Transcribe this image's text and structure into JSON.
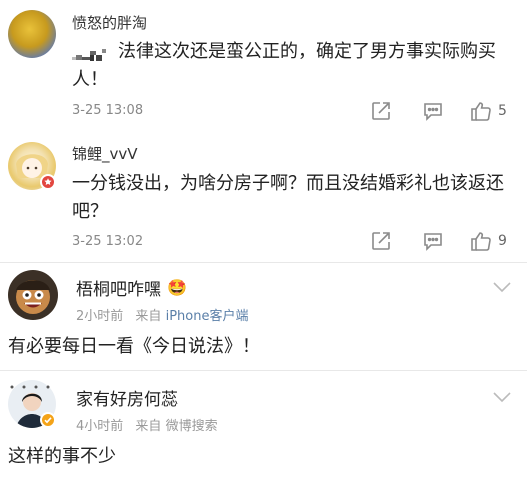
{
  "comments_top": [
    {
      "username": "愤怒的胖淘",
      "text": "法律这次还是蛮公正的，确定了男方事实际购买人！",
      "time": "3-25 13:08",
      "likes": "5"
    },
    {
      "username": "锦鲤_vvV",
      "text": "一分钱没出，为啥分房子啊？而且没结婚彩礼也该返还吧？",
      "time": "3-25 13:02",
      "likes": "9"
    }
  ],
  "comments_bottom": [
    {
      "username": "梧桐吧咋嘿",
      "crown_emoji": "🤩",
      "meta_time": "2小时前",
      "meta_from": "来自",
      "meta_source": "iPhone客户端",
      "text": "有必要每日一看《今日说法》！"
    },
    {
      "username": "家有好房何蕊",
      "meta_time": "4小时前",
      "meta_from": "来自",
      "meta_source": "微博搜索",
      "text": "这样的事不少"
    }
  ],
  "colors": {
    "verified_red": "#e2463f",
    "verified_orange": "#f4a318",
    "icon_gray": "#8a8a8a",
    "source_blue": "#5a7fa8"
  }
}
